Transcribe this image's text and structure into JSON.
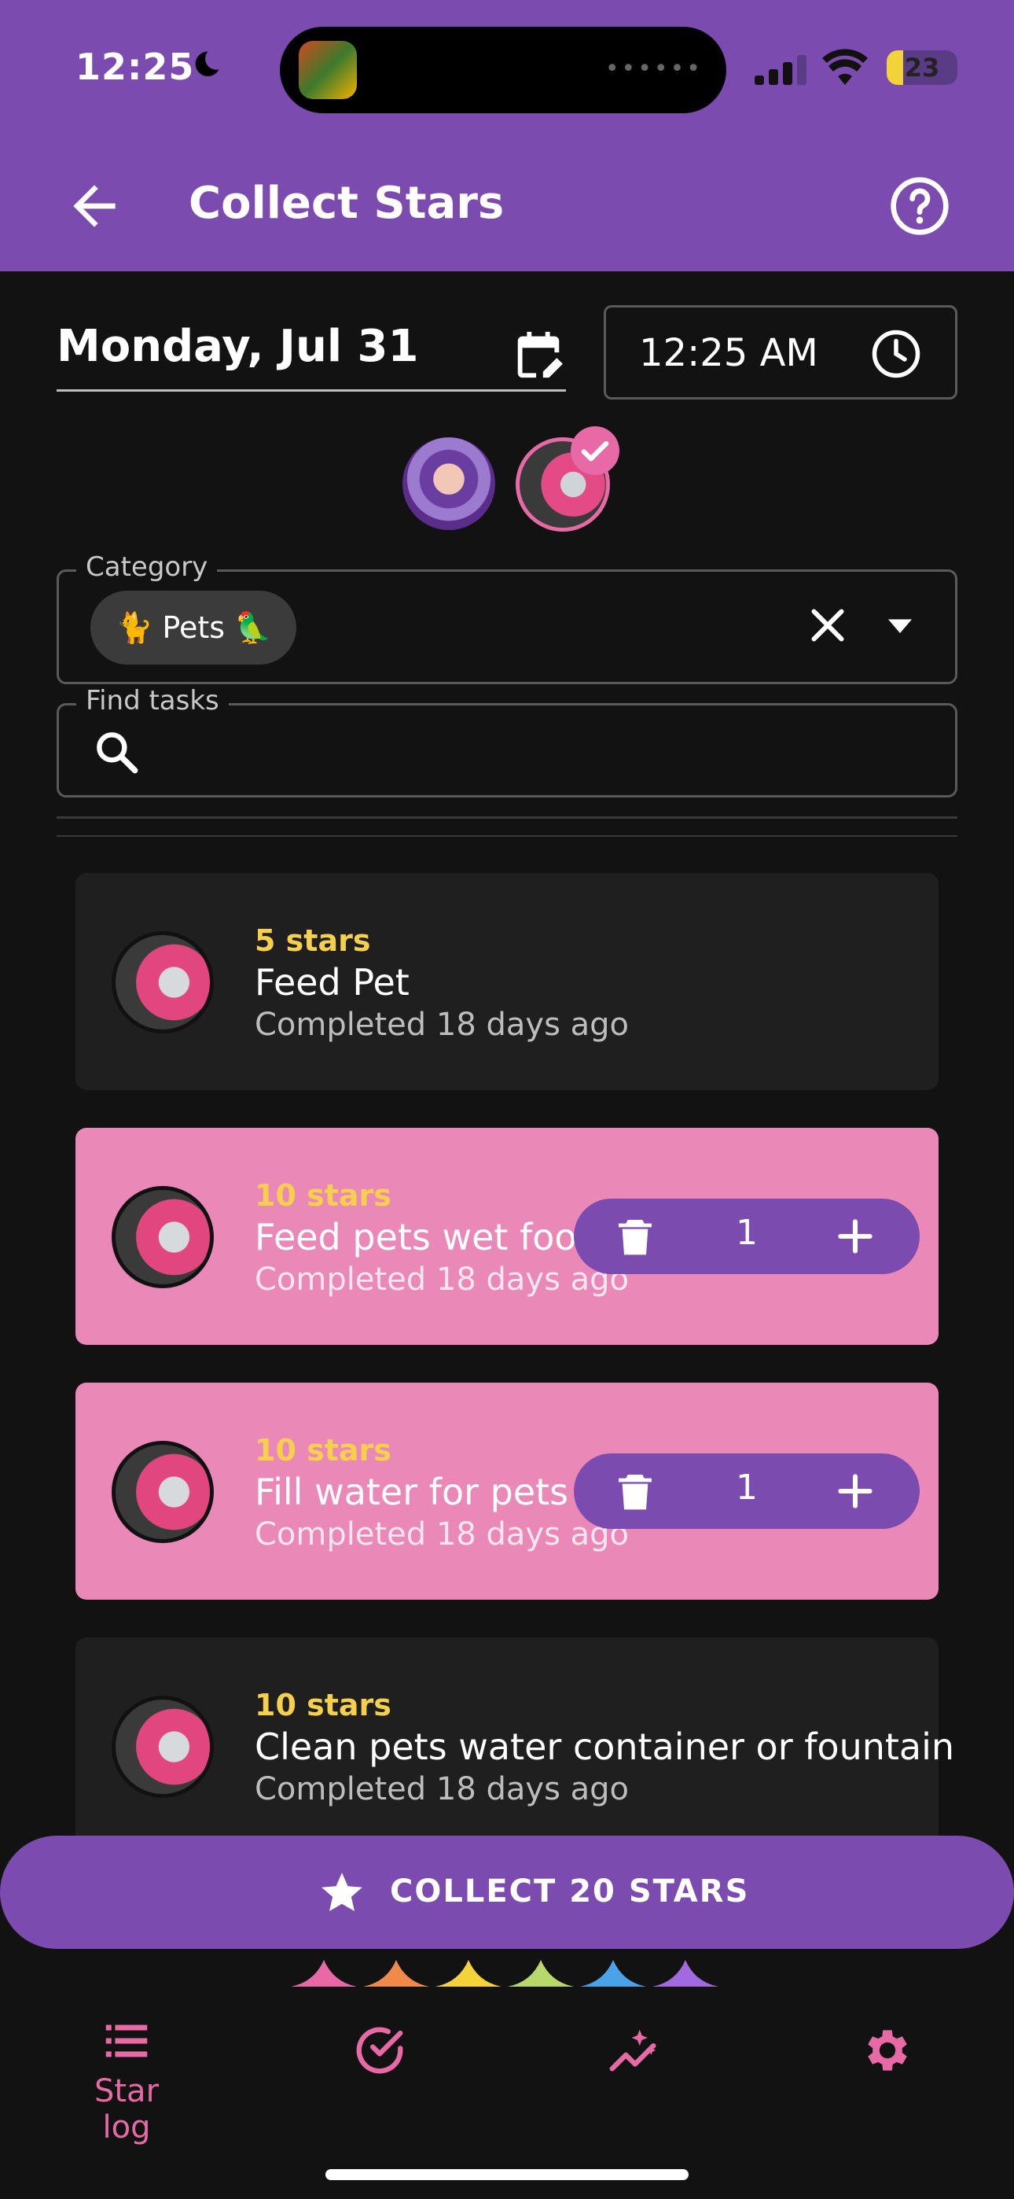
{
  "status_bar": {
    "time": "12:25",
    "battery": "23",
    "battery_level": 0.23
  },
  "app_bar": {
    "title": "Collect Stars"
  },
  "date": "Monday, Jul 31",
  "time": "12:25 AM",
  "category": {
    "label": "Category",
    "chip": "🐈 Pets 🦜"
  },
  "search": {
    "label": "Find tasks",
    "value": ""
  },
  "tasks": [
    {
      "stars": "5 stars",
      "name": "Feed Pet",
      "when": "Completed 18 days ago",
      "selected": false
    },
    {
      "stars": "10 stars",
      "name": "Feed pets wet food",
      "when": "Completed 18 days ago",
      "selected": true,
      "count": "1"
    },
    {
      "stars": "10 stars",
      "name": "Fill water for pets",
      "when": "Completed 18 days ago",
      "selected": true,
      "count": "1"
    },
    {
      "stars": "10 stars",
      "name": "Clean pets water container or fountain",
      "when": "Completed 18 days ago",
      "selected": false
    }
  ],
  "collect_button": "COLLECT 20 STARS",
  "bottom_nav": [
    {
      "label": "Star log",
      "icon": "list-icon",
      "active": true
    },
    {
      "label": "",
      "icon": "check-circle-icon"
    },
    {
      "label": "",
      "icon": "sparkle-chart-icon"
    },
    {
      "label": "",
      "icon": "gear-icon"
    }
  ],
  "colors": {
    "primary": "#7b4bb0",
    "accent": "#e76aa6",
    "star": "#f6d04d",
    "selected_card": "#ea88b8"
  }
}
